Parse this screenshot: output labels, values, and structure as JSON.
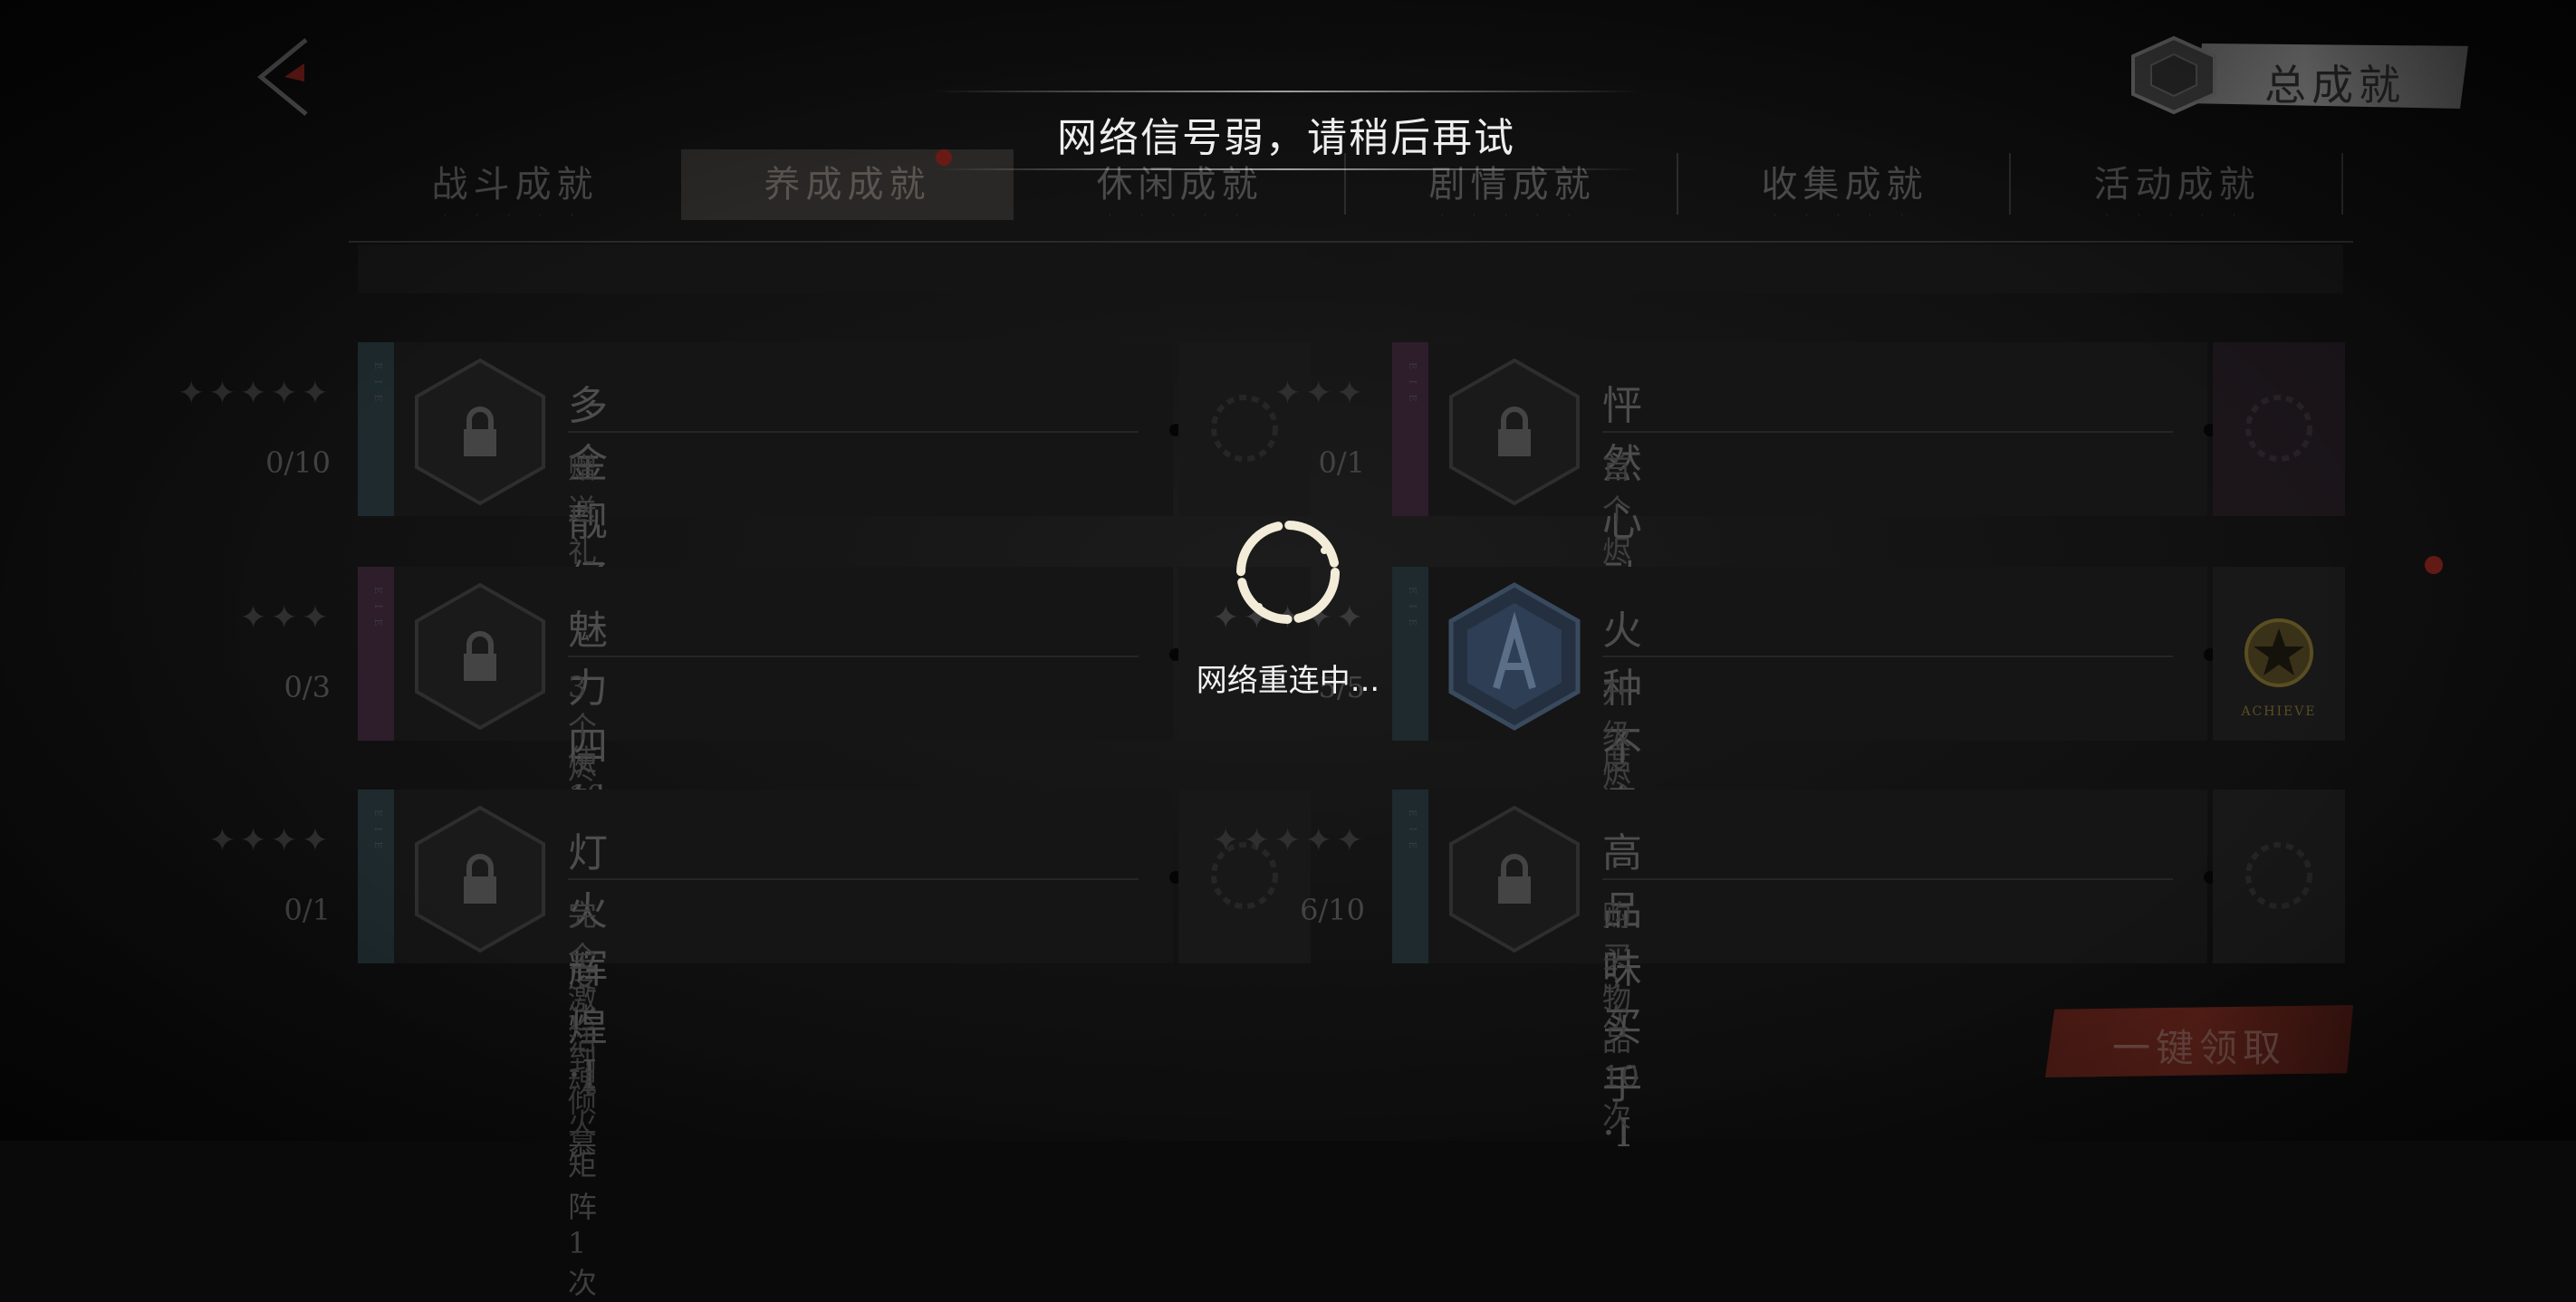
{
  "header": {
    "total_achievements_label": "总成就"
  },
  "toast": {
    "message": "网络信号弱，请稍后再试"
  },
  "tabs": [
    {
      "label": "战斗成就",
      "active": false
    },
    {
      "label": "养成成就",
      "active": true,
      "has_notification": true
    },
    {
      "label": "休闲成就",
      "active": false
    },
    {
      "label": "剧情成就",
      "active": false
    },
    {
      "label": "收集成就",
      "active": false
    },
    {
      "label": "活动成就",
      "active": false
    }
  ],
  "achievements": [
    {
      "title": "多金靓仔·I",
      "description": "赠送礼物给烬天使10次",
      "progress": "0/10",
      "stars": "✦✦✦✦✦",
      "locked": true,
      "strip_color": "#3a4a52"
    },
    {
      "title": "怦然心动·I",
      "description": "首个烬天使信任度达到善意",
      "progress": "0/1",
      "stars": "✦✦✦",
      "locked": true,
      "strip_color": "#5a2d52"
    },
    {
      "title": "魅力四射·I",
      "description": "3个烬天使信任度达到倾慕",
      "progress": "0/3",
      "stars": "✦✦✦",
      "locked": true,
      "strip_color": "#5a2d52"
    },
    {
      "title": "火种不息·I",
      "description": "升级烬天使燃点5次",
      "progress": "5/5",
      "stars": "✦✦✦✦✦",
      "locked": false,
      "strip_color": "#3a4a52",
      "reward_label": "ACHIEVE",
      "has_notification": true
    },
    {
      "title": "灯火辉煌·I",
      "description": "完全激活魂火矩阵1次",
      "progress": "0/1",
      "stars": "✦✦✦✦",
      "locked": true,
      "strip_color": "#3a4a52"
    },
    {
      "title": "高品味买手·I",
      "description": "购买物品10次",
      "progress": "6/10",
      "stars": "✦✦✦✦✦",
      "locked": true,
      "strip_color": "#3a4a52"
    }
  ],
  "loading": {
    "text": "网络重连中..."
  },
  "claim_all": {
    "label": "一键领取"
  },
  "icons": {
    "back": "back-arrow-icon",
    "lock": "lock-icon",
    "loading": "loading-spinner-icon"
  }
}
